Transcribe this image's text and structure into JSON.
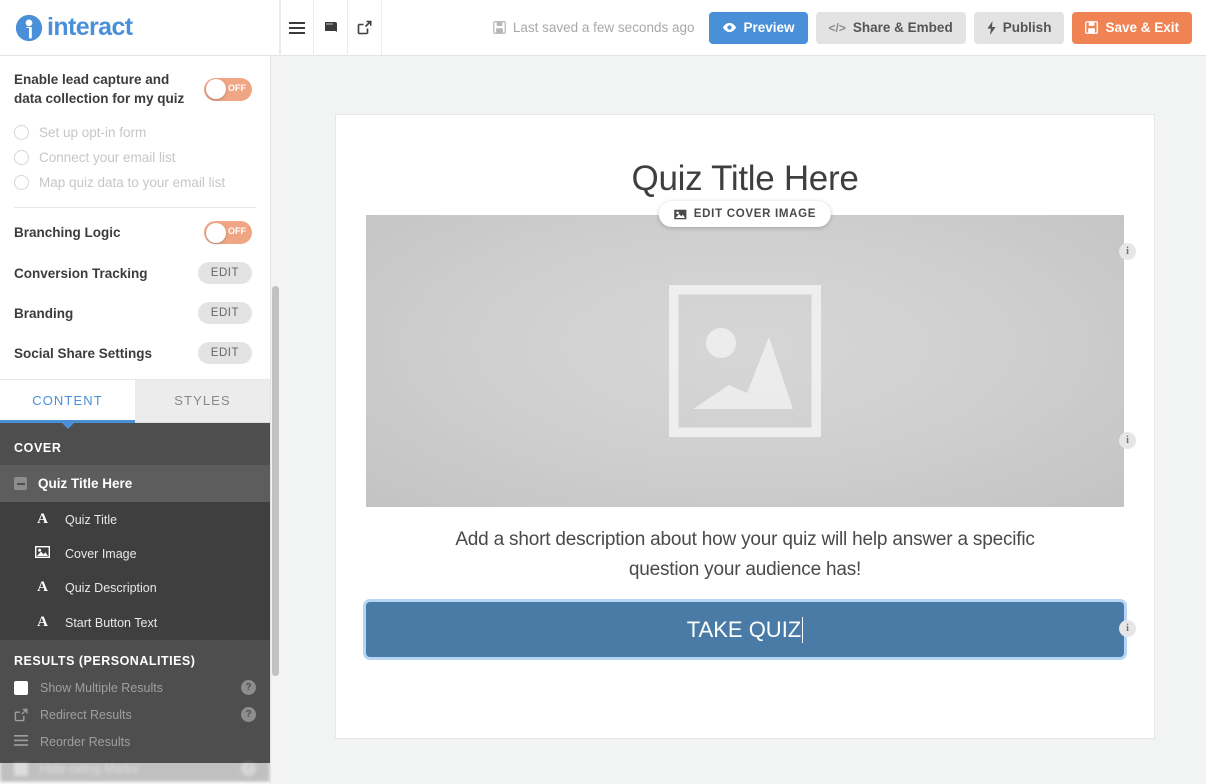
{
  "brand": {
    "name": "interact",
    "logo_icon": "interact-logo-icon",
    "accent_blue": "#4a90d9",
    "accent_orange": "#ef8354"
  },
  "topbar": {
    "icons": [
      {
        "name": "hamburger-menu-icon",
        "glyph": "☰"
      },
      {
        "name": "book-icon",
        "glyph": "📕"
      },
      {
        "name": "external-link-icon",
        "glyph": "↗"
      }
    ],
    "save_status": {
      "icon": "floppy-disk-icon",
      "text": "Last saved a few seconds ago"
    },
    "buttons": [
      {
        "name": "preview-button",
        "label": "Preview",
        "icon": "eye-icon",
        "glyph": "👁",
        "style": "blue"
      },
      {
        "name": "share-embed-button",
        "label": "Share & Embed",
        "icon": "code-icon",
        "glyph": "</>",
        "style": "grey"
      },
      {
        "name": "publish-button",
        "label": "Publish",
        "icon": "lightning-bolt-icon",
        "glyph": "⚡",
        "style": "grey"
      },
      {
        "name": "save-exit-button",
        "label": "Save & Exit",
        "icon": "floppy-disk-icon",
        "glyph": "💾",
        "style": "orange"
      }
    ]
  },
  "sidebar": {
    "lead_capture": {
      "label": "Enable lead capture and data collection for my quiz",
      "toggle_state": "OFF"
    },
    "substeps": [
      {
        "label": "Set up opt-in form"
      },
      {
        "label": "Connect your email list"
      },
      {
        "label": "Map quiz data to your email list"
      }
    ],
    "settings": [
      {
        "label": "Branching Logic",
        "control": "toggle",
        "toggle_state": "OFF"
      },
      {
        "label": "Conversion Tracking",
        "control": "edit",
        "action_label": "EDIT"
      },
      {
        "label": "Branding",
        "control": "edit",
        "action_label": "EDIT"
      },
      {
        "label": "Social Share Settings",
        "control": "edit",
        "action_label": "EDIT"
      }
    ],
    "tabs": [
      {
        "label": "CONTENT",
        "active": true
      },
      {
        "label": "STYLES",
        "active": false
      }
    ],
    "tree": {
      "section_label": "COVER",
      "parent": {
        "label": "Quiz Title Here",
        "icon": "collapse-box-icon"
      },
      "children": [
        {
          "label": "Quiz Title",
          "icon": "text-icon",
          "glyph": "A"
        },
        {
          "label": "Cover Image",
          "icon": "image-icon",
          "glyph": "🖼"
        },
        {
          "label": "Quiz Description",
          "icon": "text-icon",
          "glyph": "A"
        },
        {
          "label": "Start Button Text",
          "icon": "text-icon",
          "glyph": "A"
        }
      ]
    },
    "results": {
      "section_label": "RESULTS (PERSONALITIES)",
      "rows": [
        {
          "label": "Show Multiple Results",
          "icon": "checkbox-icon",
          "help": "?"
        },
        {
          "label": "Redirect Results",
          "icon": "external-link-icon",
          "glyph": "↗",
          "help": "?"
        },
        {
          "label": "Reorder Results",
          "icon": "reorder-icon",
          "glyph": "☰",
          "help": ""
        },
        {
          "label": "Hide rating Marks",
          "icon": "eye-icon",
          "glyph": "👁",
          "help": "?"
        }
      ]
    }
  },
  "canvas": {
    "quiz_title": "Quiz Title Here",
    "edit_cover_button": {
      "label": "EDIT COVER IMAGE",
      "icon": "image-icon",
      "glyph": "🖼"
    },
    "cover_placeholder_icon": "image-placeholder-icon",
    "quiz_description": "Add a short description about how your quiz will help answer a specific question your audience has!",
    "start_button_label": "TAKE QUIZ",
    "info_badges": [
      {
        "glyph": "i"
      },
      {
        "glyph": "i"
      },
      {
        "glyph": "i"
      }
    ]
  }
}
